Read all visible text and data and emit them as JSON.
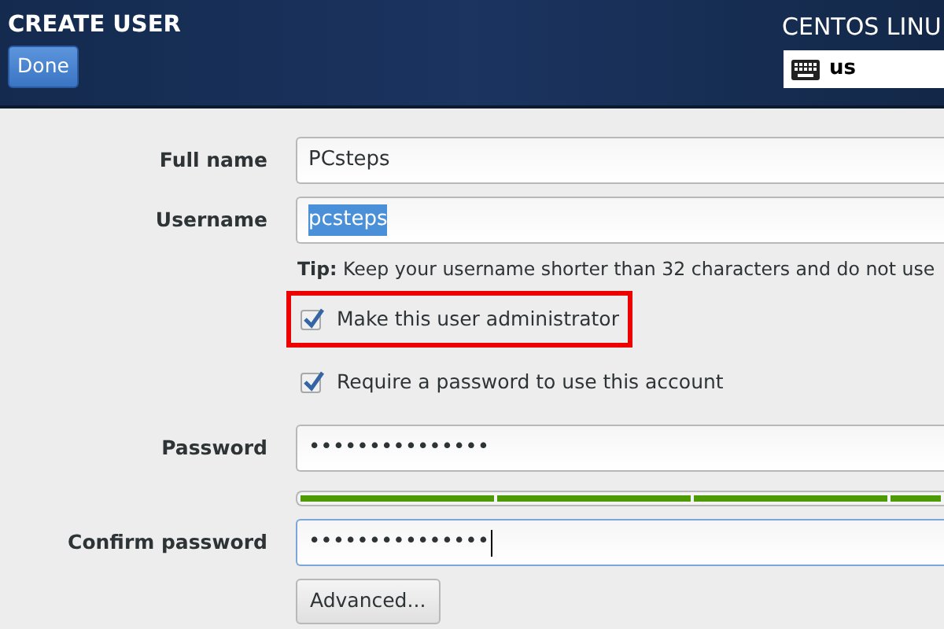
{
  "header": {
    "title": "CREATE USER",
    "done_button": "Done",
    "product": "CENTOS LINU",
    "keyboard_layout": "us"
  },
  "fields": [
    {
      "kind": "text",
      "label": "Full name",
      "value": "PCsteps",
      "text_selected": false,
      "focused": false
    },
    {
      "kind": "text",
      "label": "Username",
      "value": "pcsteps",
      "text_selected": true,
      "focused": false
    },
    {
      "kind": "tip",
      "lead": "Tip:",
      "text": "Keep your username shorter than 32 characters and do not use"
    },
    {
      "kind": "checkbox",
      "label": "Make this user administrator",
      "checked": true,
      "highlighted": true
    },
    {
      "kind": "checkbox",
      "label": "Require a password to use this account",
      "checked": true,
      "highlighted": false
    },
    {
      "kind": "text",
      "label": "Password",
      "value": "•••••••••••••••",
      "text_selected": false,
      "focused": false
    },
    {
      "kind": "meter",
      "level": 1
    },
    {
      "kind": "text",
      "label": "Confirm password",
      "value": "•••••••••••••••",
      "text_selected": false,
      "focused": true
    },
    {
      "kind": "button",
      "label": "Advanced..."
    }
  ]
}
